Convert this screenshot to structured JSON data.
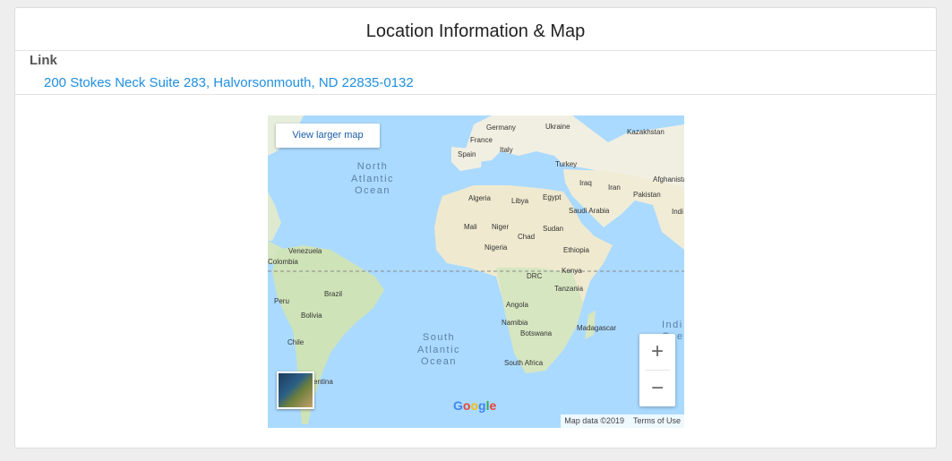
{
  "card": {
    "title": "Location Information & Map"
  },
  "field": {
    "label": "Link",
    "address": "200 Stokes Neck Suite 283, Halvorsonmouth, ND 22835-0132"
  },
  "map": {
    "view_larger": "View larger map",
    "zoom_in": "+",
    "zoom_out": "−",
    "brand": [
      "G",
      "o",
      "o",
      "g",
      "l",
      "e"
    ],
    "brand_colors": [
      "#4285F4",
      "#EA4335",
      "#FBBC05",
      "#4285F4",
      "#34A853",
      "#EA4335"
    ],
    "attribution": "Map data ©2019",
    "terms": "Terms of Use",
    "oceans": {
      "north_atlantic": [
        "North",
        "Atlantic",
        "Ocean"
      ],
      "south_atlantic": [
        "South",
        "Atlantic",
        "Ocean"
      ],
      "indian": [
        "Indi",
        "Oce"
      ]
    },
    "countries": {
      "germany": "Germany",
      "ukraine": "Ukraine",
      "kazakhstan": "Kazakhstan",
      "france": "France",
      "spain": "Spain",
      "italy": "Italy",
      "turkey": "Turkey",
      "afghanistan": "Afghanistan",
      "iraq": "Iraq",
      "iran": "Iran",
      "pakistan": "Pakistan",
      "algeria": "Algeria",
      "libya": "Libya",
      "egypt": "Egypt",
      "saudi": "Saudi Arabia",
      "india": "Indi",
      "mali": "Mali",
      "niger": "Niger",
      "chad": "Chad",
      "sudan": "Sudan",
      "nigeria": "Nigeria",
      "ethiopia": "Ethiopia",
      "venezuela": "Venezuela",
      "colombia": "Colombia",
      "kenya": "Kenya",
      "drc": "DRC",
      "tanzania": "Tanzania",
      "brazil": "Brazil",
      "peru": "Peru",
      "angola": "Angola",
      "bolivia": "Bolivia",
      "namibia": "Namibia",
      "madagascar": "Madagascar",
      "botswana": "Botswana",
      "chile": "Chile",
      "south_africa": "South Africa",
      "argentina": "entina"
    }
  }
}
